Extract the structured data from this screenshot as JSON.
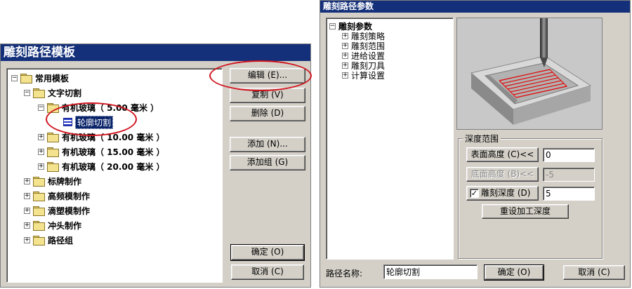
{
  "template_window": {
    "title": "雕刻路径模板",
    "tree": [
      {
        "label": "常用模板",
        "expanded": true
      },
      {
        "label": "文字切割",
        "expanded": true
      },
      {
        "label": "有机玻璃（ 5.00  毫米 ）",
        "expanded": true
      },
      {
        "label": "轮廓切割",
        "selected": true
      },
      {
        "label": "有机玻璃（ 10.00  毫米 ）",
        "expanded": false
      },
      {
        "label": "有机玻璃（ 15.00  毫米 ）",
        "expanded": false
      },
      {
        "label": "有机玻璃（ 20.00  毫米 ）",
        "expanded": false
      },
      {
        "label": "标牌制作",
        "expanded": false
      },
      {
        "label": "高频模制作",
        "expanded": false
      },
      {
        "label": "滴塑模制作",
        "expanded": false
      },
      {
        "label": "冲头制作",
        "expanded": false
      },
      {
        "label": "路径组",
        "expanded": false
      }
    ],
    "buttons": {
      "edit": "编辑 (E)...",
      "copy": "复制 (V)",
      "delete": "删除 (D)",
      "add": "添加 (N)...",
      "add_group": "添加组 (G)",
      "ok": "确定 (O)",
      "cancel": "取消 (C)"
    }
  },
  "params_window": {
    "title": "雕刻路径参数",
    "tree_root": "雕刻参数",
    "tree_children": [
      "雕刻策略",
      "雕刻范围",
      "进给设置",
      "雕刻刀具",
      "计算设置"
    ],
    "depth_group": {
      "label": "深度范围",
      "surface_height_button": "表面高度 (C)<<",
      "surface_height_value": "0",
      "bottom_height_button": "底面高度 (B)<<",
      "bottom_height_value": "-5",
      "engrave_depth_label": "雕刻深度 (D)",
      "engrave_depth_checked": true,
      "engrave_depth_value": "5",
      "reset_button": "重设加工深度"
    },
    "path_name_label": "路径名称:",
    "path_name_value": "轮廓切割",
    "ok": "确定 (O)",
    "cancel": "取消 (C)"
  },
  "colors": {
    "titlebar": "#14307a",
    "annotation": "#d0141e",
    "selection": "#0a246a"
  }
}
